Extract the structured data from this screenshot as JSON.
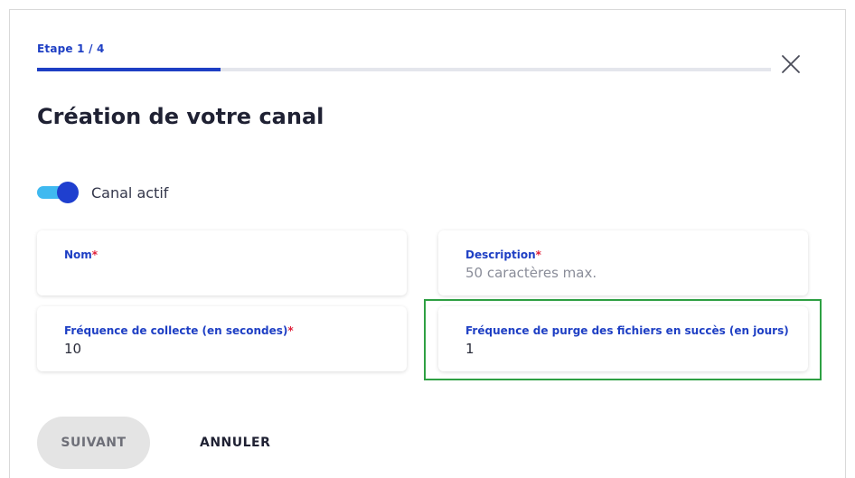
{
  "stepper": {
    "label": "Etape 1 / 4",
    "current": 1,
    "total": 4,
    "progress": 0.25
  },
  "colors": {
    "accent": "#1e3fc4",
    "toggle_track": "#3fb9f0",
    "required": "#e0203a",
    "highlight": "#2ea043"
  },
  "icons": {
    "close": "close-icon"
  },
  "dialog": {
    "title": "Création de votre canal"
  },
  "toggle": {
    "label": "Canal actif",
    "checked": true
  },
  "fields": {
    "nom": {
      "label": "Nom",
      "required_mark": "*",
      "value": ""
    },
    "description": {
      "label": "Description",
      "required_mark": "*",
      "placeholder": "50 caractères max."
    },
    "frequence_collecte": {
      "label": "Fréquence de collecte (en secondes)",
      "required_mark": "*",
      "value": "10"
    },
    "frequence_purge": {
      "label": "Fréquence de purge des fichiers en succès (en jours)",
      "value": "1"
    }
  },
  "actions": {
    "next_label": "SUIVANT",
    "cancel_label": "ANNULER"
  }
}
